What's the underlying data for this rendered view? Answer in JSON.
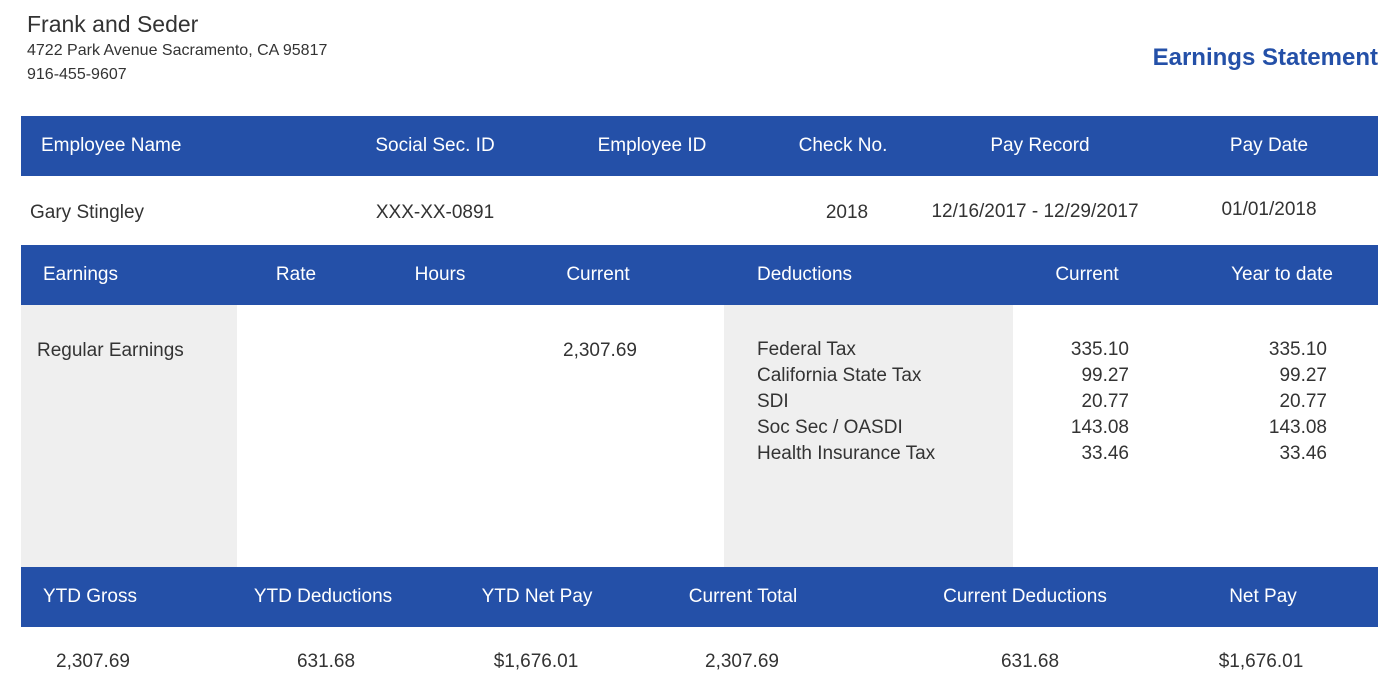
{
  "company": {
    "name": "Frank and Seder",
    "address": "4722 Park Avenue Sacramento, CA 95817",
    "phone": "916-455-9607"
  },
  "document_title": "Earnings Statement",
  "colors": {
    "header_bar": "#2450a8",
    "title": "#2450a8",
    "shaded_column": "#efefef",
    "text": "#333333"
  },
  "employee_header": {
    "columns": [
      "Employee Name",
      "Social Sec. ID",
      "Employee ID",
      "Check No.",
      "Pay Record",
      "Pay Date"
    ]
  },
  "employee": {
    "name": "Gary Stingley",
    "ssn": "XXX-XX-0891",
    "employee_id": "",
    "check_no": "2018",
    "pay_record": "12/16/2017 - 12/29/2017",
    "pay_date": "01/01/2018"
  },
  "earnings_header": {
    "columns": [
      "Earnings",
      "Rate",
      "Hours",
      "Current",
      "Deductions",
      "Current",
      "Year to date"
    ]
  },
  "earnings": [
    {
      "label": "Regular Earnings",
      "rate": "",
      "hours": "",
      "current": "2,307.69"
    }
  ],
  "deductions": [
    {
      "label": "Federal Tax",
      "current": "335.10",
      "ytd": "335.10"
    },
    {
      "label": "California State Tax",
      "current": "99.27",
      "ytd": "99.27"
    },
    {
      "label": "SDI",
      "current": "20.77",
      "ytd": "20.77"
    },
    {
      "label": "Soc Sec / OASDI",
      "current": "143.08",
      "ytd": "143.08"
    },
    {
      "label": "Health Insurance Tax",
      "current": "33.46",
      "ytd": "33.46"
    }
  ],
  "summary_header": {
    "columns": [
      "YTD Gross",
      "YTD Deductions",
      "YTD Net Pay",
      "Current Total",
      "Current Deductions",
      "Net Pay"
    ]
  },
  "summary": {
    "ytd_gross": "2,307.69",
    "ytd_deductions": "631.68",
    "ytd_net_pay": "$1,676.01",
    "current_total": "2,307.69",
    "current_deductions": "631.68",
    "net_pay": "$1,676.01"
  }
}
